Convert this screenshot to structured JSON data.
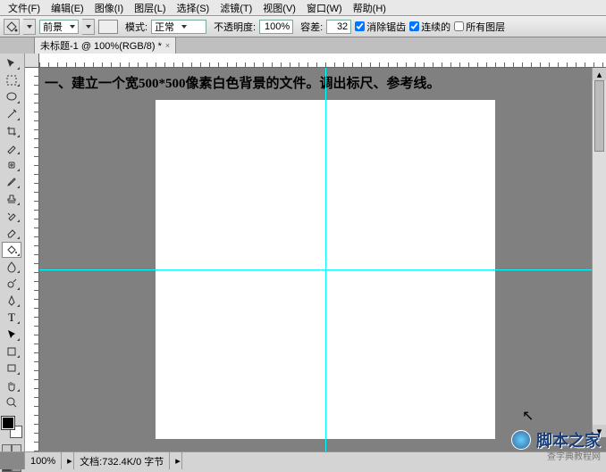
{
  "menu": [
    "文件(F)",
    "编辑(E)",
    "图像(I)",
    "图层(L)",
    "选择(S)",
    "滤镜(T)",
    "视图(V)",
    "窗口(W)",
    "帮助(H)"
  ],
  "opt": {
    "fg": "前景",
    "mode_lbl": "模式:",
    "mode": "正常",
    "opacity_lbl": "不透明度:",
    "opacity": "100%",
    "tol_lbl": "容差:",
    "tol": "32",
    "aa": "消除锯齿",
    "contig": "连续的",
    "all": "所有图层"
  },
  "tab": {
    "title": "未标题-1 @ 100%(RGB/8) *"
  },
  "instruction": "一、建立一个宽500*500像素白色背景的文件。调出标尺、参考线。",
  "status": {
    "zoom": "100%",
    "doc": "文档:732.4K/0 字节"
  },
  "watermark": {
    "text": "脚本之家",
    "sub": "查字典教程网"
  }
}
